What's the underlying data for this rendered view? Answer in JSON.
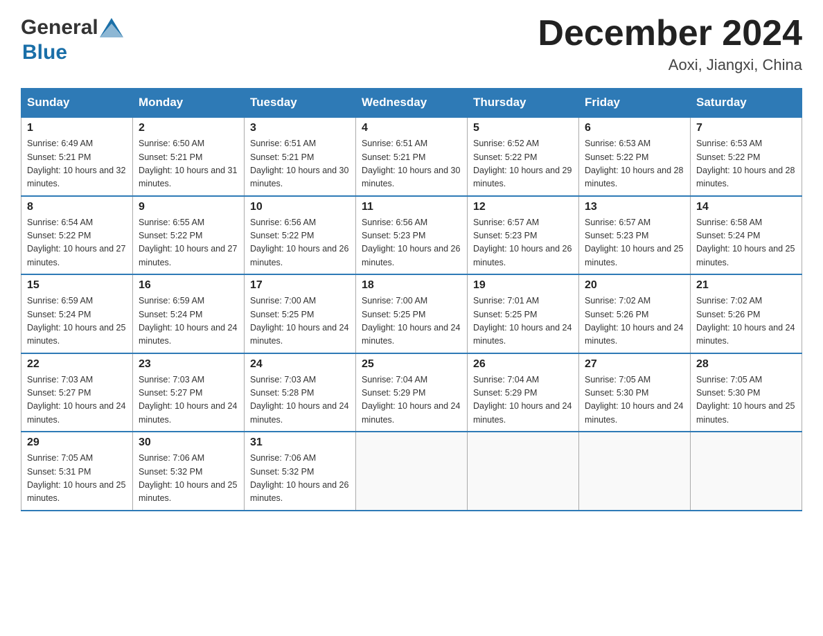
{
  "header": {
    "logo_general": "General",
    "logo_blue": "Blue",
    "month_title": "December 2024",
    "location": "Aoxi, Jiangxi, China"
  },
  "days_of_week": [
    "Sunday",
    "Monday",
    "Tuesday",
    "Wednesday",
    "Thursday",
    "Friday",
    "Saturday"
  ],
  "weeks": [
    [
      {
        "day": "1",
        "sunrise": "Sunrise: 6:49 AM",
        "sunset": "Sunset: 5:21 PM",
        "daylight": "Daylight: 10 hours and 32 minutes."
      },
      {
        "day": "2",
        "sunrise": "Sunrise: 6:50 AM",
        "sunset": "Sunset: 5:21 PM",
        "daylight": "Daylight: 10 hours and 31 minutes."
      },
      {
        "day": "3",
        "sunrise": "Sunrise: 6:51 AM",
        "sunset": "Sunset: 5:21 PM",
        "daylight": "Daylight: 10 hours and 30 minutes."
      },
      {
        "day": "4",
        "sunrise": "Sunrise: 6:51 AM",
        "sunset": "Sunset: 5:21 PM",
        "daylight": "Daylight: 10 hours and 30 minutes."
      },
      {
        "day": "5",
        "sunrise": "Sunrise: 6:52 AM",
        "sunset": "Sunset: 5:22 PM",
        "daylight": "Daylight: 10 hours and 29 minutes."
      },
      {
        "day": "6",
        "sunrise": "Sunrise: 6:53 AM",
        "sunset": "Sunset: 5:22 PM",
        "daylight": "Daylight: 10 hours and 28 minutes."
      },
      {
        "day": "7",
        "sunrise": "Sunrise: 6:53 AM",
        "sunset": "Sunset: 5:22 PM",
        "daylight": "Daylight: 10 hours and 28 minutes."
      }
    ],
    [
      {
        "day": "8",
        "sunrise": "Sunrise: 6:54 AM",
        "sunset": "Sunset: 5:22 PM",
        "daylight": "Daylight: 10 hours and 27 minutes."
      },
      {
        "day": "9",
        "sunrise": "Sunrise: 6:55 AM",
        "sunset": "Sunset: 5:22 PM",
        "daylight": "Daylight: 10 hours and 27 minutes."
      },
      {
        "day": "10",
        "sunrise": "Sunrise: 6:56 AM",
        "sunset": "Sunset: 5:22 PM",
        "daylight": "Daylight: 10 hours and 26 minutes."
      },
      {
        "day": "11",
        "sunrise": "Sunrise: 6:56 AM",
        "sunset": "Sunset: 5:23 PM",
        "daylight": "Daylight: 10 hours and 26 minutes."
      },
      {
        "day": "12",
        "sunrise": "Sunrise: 6:57 AM",
        "sunset": "Sunset: 5:23 PM",
        "daylight": "Daylight: 10 hours and 26 minutes."
      },
      {
        "day": "13",
        "sunrise": "Sunrise: 6:57 AM",
        "sunset": "Sunset: 5:23 PM",
        "daylight": "Daylight: 10 hours and 25 minutes."
      },
      {
        "day": "14",
        "sunrise": "Sunrise: 6:58 AM",
        "sunset": "Sunset: 5:24 PM",
        "daylight": "Daylight: 10 hours and 25 minutes."
      }
    ],
    [
      {
        "day": "15",
        "sunrise": "Sunrise: 6:59 AM",
        "sunset": "Sunset: 5:24 PM",
        "daylight": "Daylight: 10 hours and 25 minutes."
      },
      {
        "day": "16",
        "sunrise": "Sunrise: 6:59 AM",
        "sunset": "Sunset: 5:24 PM",
        "daylight": "Daylight: 10 hours and 24 minutes."
      },
      {
        "day": "17",
        "sunrise": "Sunrise: 7:00 AM",
        "sunset": "Sunset: 5:25 PM",
        "daylight": "Daylight: 10 hours and 24 minutes."
      },
      {
        "day": "18",
        "sunrise": "Sunrise: 7:00 AM",
        "sunset": "Sunset: 5:25 PM",
        "daylight": "Daylight: 10 hours and 24 minutes."
      },
      {
        "day": "19",
        "sunrise": "Sunrise: 7:01 AM",
        "sunset": "Sunset: 5:25 PM",
        "daylight": "Daylight: 10 hours and 24 minutes."
      },
      {
        "day": "20",
        "sunrise": "Sunrise: 7:02 AM",
        "sunset": "Sunset: 5:26 PM",
        "daylight": "Daylight: 10 hours and 24 minutes."
      },
      {
        "day": "21",
        "sunrise": "Sunrise: 7:02 AM",
        "sunset": "Sunset: 5:26 PM",
        "daylight": "Daylight: 10 hours and 24 minutes."
      }
    ],
    [
      {
        "day": "22",
        "sunrise": "Sunrise: 7:03 AM",
        "sunset": "Sunset: 5:27 PM",
        "daylight": "Daylight: 10 hours and 24 minutes."
      },
      {
        "day": "23",
        "sunrise": "Sunrise: 7:03 AM",
        "sunset": "Sunset: 5:27 PM",
        "daylight": "Daylight: 10 hours and 24 minutes."
      },
      {
        "day": "24",
        "sunrise": "Sunrise: 7:03 AM",
        "sunset": "Sunset: 5:28 PM",
        "daylight": "Daylight: 10 hours and 24 minutes."
      },
      {
        "day": "25",
        "sunrise": "Sunrise: 7:04 AM",
        "sunset": "Sunset: 5:29 PM",
        "daylight": "Daylight: 10 hours and 24 minutes."
      },
      {
        "day": "26",
        "sunrise": "Sunrise: 7:04 AM",
        "sunset": "Sunset: 5:29 PM",
        "daylight": "Daylight: 10 hours and 24 minutes."
      },
      {
        "day": "27",
        "sunrise": "Sunrise: 7:05 AM",
        "sunset": "Sunset: 5:30 PM",
        "daylight": "Daylight: 10 hours and 24 minutes."
      },
      {
        "day": "28",
        "sunrise": "Sunrise: 7:05 AM",
        "sunset": "Sunset: 5:30 PM",
        "daylight": "Daylight: 10 hours and 25 minutes."
      }
    ],
    [
      {
        "day": "29",
        "sunrise": "Sunrise: 7:05 AM",
        "sunset": "Sunset: 5:31 PM",
        "daylight": "Daylight: 10 hours and 25 minutes."
      },
      {
        "day": "30",
        "sunrise": "Sunrise: 7:06 AM",
        "sunset": "Sunset: 5:32 PM",
        "daylight": "Daylight: 10 hours and 25 minutes."
      },
      {
        "day": "31",
        "sunrise": "Sunrise: 7:06 AM",
        "sunset": "Sunset: 5:32 PM",
        "daylight": "Daylight: 10 hours and 26 minutes."
      },
      null,
      null,
      null,
      null
    ]
  ]
}
